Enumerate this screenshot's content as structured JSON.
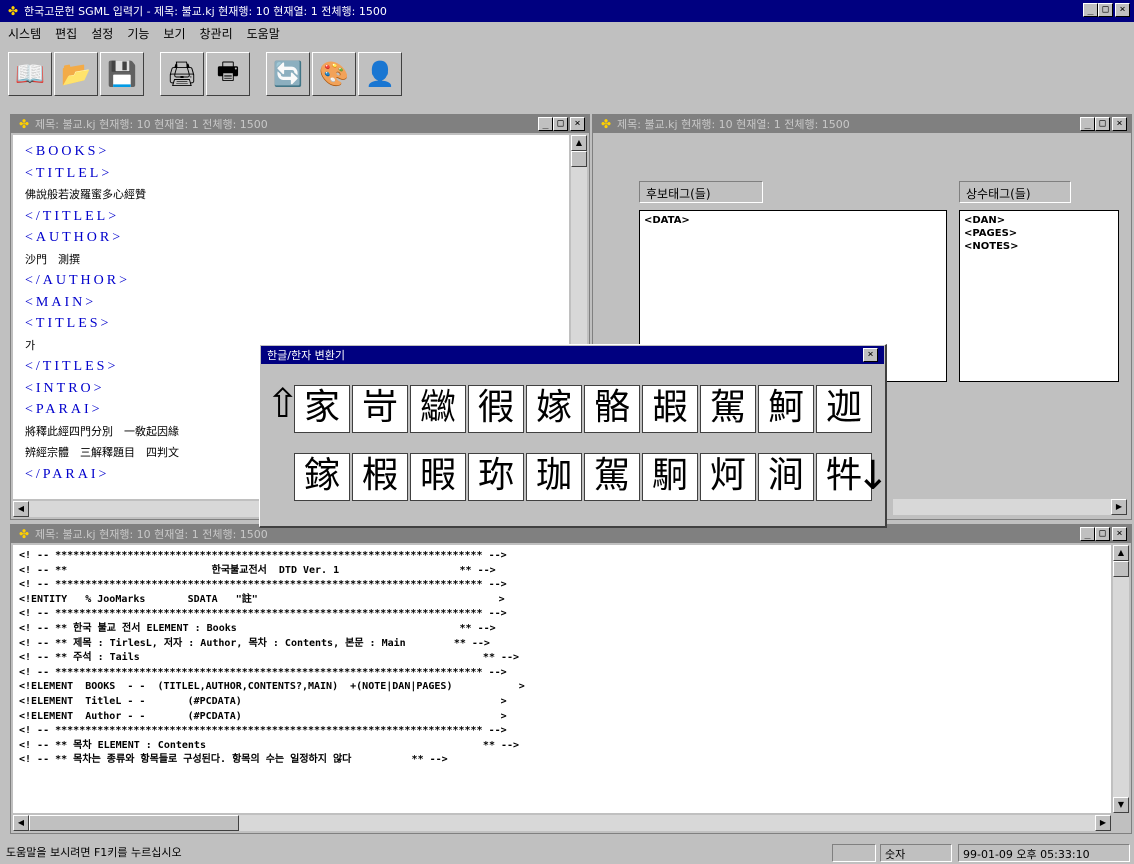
{
  "app": {
    "title": "한국고문헌 SGML 입력기 - 제목: 불교.kj 현재행: 10 현재열: 1 전체행: 1500"
  },
  "menu": [
    "시스템",
    "편집",
    "설정",
    "기능",
    "보기",
    "창관리",
    "도움말"
  ],
  "toolbar": [
    {
      "name": "open-book-icon",
      "glyph": "📖"
    },
    {
      "name": "open-folder-icon",
      "glyph": "📂"
    },
    {
      "name": "save-icon",
      "glyph": "💾"
    },
    {
      "name": "print-preview-icon",
      "glyph": "🖨"
    },
    {
      "name": "printer-icon",
      "glyph": "🖶"
    },
    {
      "name": "convert-icon",
      "glyph": "🔄"
    },
    {
      "name": "color-icon",
      "glyph": "🎨"
    },
    {
      "name": "user-icon",
      "glyph": "👤"
    }
  ],
  "editor": {
    "title": "제목: 불교.kj 현재행: 10 현재열: 1 전체행: 1500"
  },
  "tags": {
    "title": "제목: 불교.kj 현재행: 10 현재열: 1 전체행: 1500",
    "candidate_label": "후보태그(들)",
    "candidate_items": [
      "<DATA>"
    ],
    "repeat_label": "상수태그(들)",
    "repeat_items": [
      "<DAN>",
      "<PAGES>",
      "<NOTES>"
    ]
  },
  "dtd": {
    "title": "제목: 불교.kj 현재행: 10 현재열: 1 전체행: 1500"
  },
  "dialog": {
    "title": "한글/한자 변환기",
    "up_arrow": "⇧",
    "down_arrow": "↓",
    "row1": [
      "家",
      "岢",
      "㱍",
      "徦",
      "嫁",
      "骼",
      "嘏",
      "駕",
      "魺",
      "迦"
    ],
    "row2": [
      "鎵",
      "椵",
      "暇",
      "珎",
      "珈",
      "駕",
      "駉",
      "炣",
      "涧",
      "牪"
    ]
  },
  "status": {
    "help": "도움말을 보시려면 F1키를 누르십시오",
    "mode": "숫자",
    "datetime": "99-01-09 오후 05:33:10"
  }
}
